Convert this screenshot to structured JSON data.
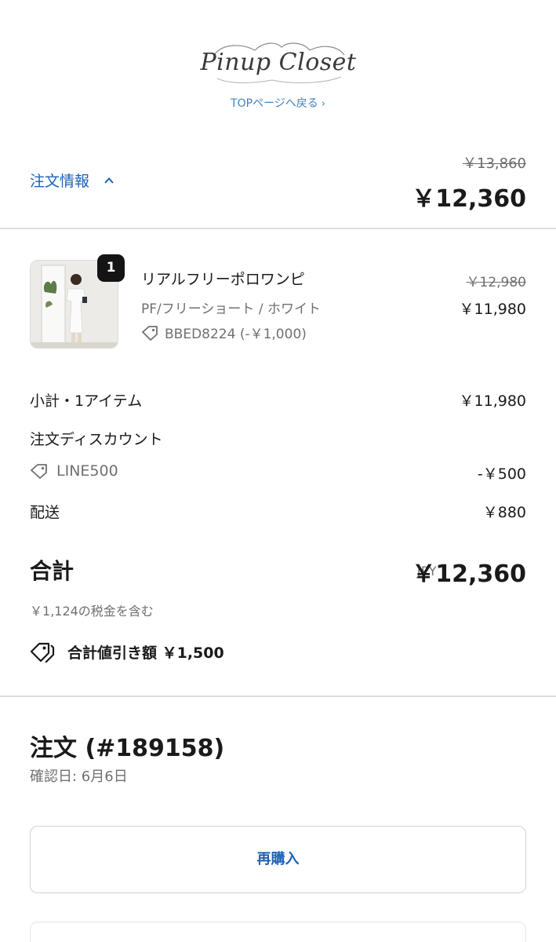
{
  "header": {
    "logo_text": "Pinup Closet",
    "top_link": "TOPページへ戻る",
    "top_link_chevron": "›"
  },
  "summary_bar": {
    "toggle_label": "注文情報",
    "original_total": "￥13,860",
    "total": "￥12,360"
  },
  "line_item": {
    "quantity": "1",
    "name": "リアルフリーポロワンピ",
    "variant": "PF/フリーショート / ホワイト",
    "discount": "BBED8224  (-￥1,000)",
    "original_price": "￥12,980",
    "price": "￥11,980"
  },
  "totals": {
    "subtotal_label": "小計・1アイテム",
    "subtotal_value": "￥11,980",
    "order_discount_label": "注文ディスカウント",
    "discount_code": "LINE500",
    "discount_value": "-￥500",
    "shipping_label": "配送",
    "shipping_value": "￥880",
    "total_label": "合計",
    "currency": "JPY",
    "total_value": "￥12,360",
    "tax_note": "￥1,124の税金を含む",
    "savings": "合計値引き額 ￥1,500"
  },
  "order": {
    "title": "注文 (#189158)",
    "confirmed": "確認日: 6月6日",
    "rebuy_label": "再購入"
  },
  "colors": {
    "link": "#1a63b8",
    "top_link": "#3d83c4",
    "muted": "#707070"
  }
}
